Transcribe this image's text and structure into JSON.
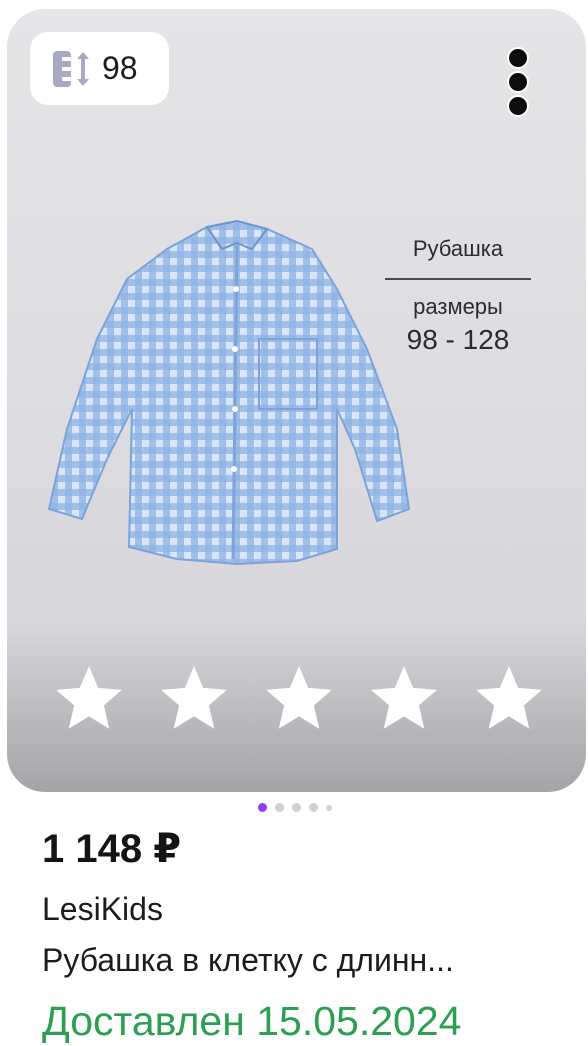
{
  "product": {
    "size_badge": "98",
    "photo_caption": {
      "title": "Рубашка",
      "subtitle": "размеры",
      "range": "98 - 128"
    },
    "rating_stars": 5,
    "price": "1 148 ₽",
    "brand": "LesiKids",
    "title": "Рубашка в клетку с длинн...",
    "delivery_status": "Доставлен 15.05.2024"
  },
  "carousel": {
    "total": 5,
    "active_index": 0
  },
  "colors": {
    "delivery_green": "#2e9e53",
    "pager_active": "#8a3ffc",
    "shirt_blue": "#9ebfe8"
  },
  "icons": [
    "size-chart-icon",
    "more-vertical-icon",
    "star-icon"
  ]
}
